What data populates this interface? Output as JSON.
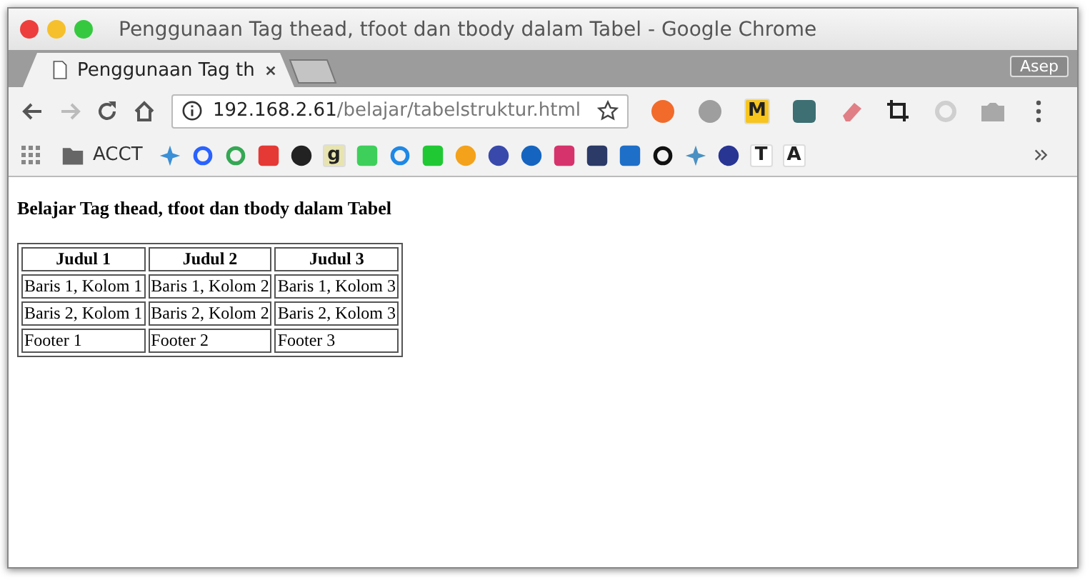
{
  "window": {
    "title": "Penggunaan Tag thead, tfoot dan tbody dalam Tabel - Google Chrome"
  },
  "tabs": [
    {
      "label": "Penggunaan Tag th",
      "selected": true
    }
  ],
  "profile": "Asep",
  "address": {
    "host": "192.168.2.61",
    "path": "/belajar/tabelstruktur.html"
  },
  "extensions": [
    {
      "kind": "dot",
      "color": "#f26b2a"
    },
    {
      "kind": "dot",
      "color": "#9e9e9e"
    },
    {
      "kind": "letter",
      "glyph": "M",
      "color": "#f7c51e"
    },
    {
      "kind": "square",
      "color": "#3d6f73"
    },
    {
      "kind": "eraser",
      "color": "#e07f85"
    },
    {
      "kind": "crop",
      "color": "#222222"
    },
    {
      "kind": "ring",
      "color": "#cfcfcf"
    },
    {
      "kind": "camera",
      "color": "#a8a8a8"
    }
  ],
  "bookmarks": [
    {
      "kind": "folder",
      "label": "ACCT"
    },
    {
      "kind": "star",
      "color": "#3a8fd6"
    },
    {
      "kind": "ring",
      "color": "#2962ff"
    },
    {
      "kind": "ring",
      "color": "#34a853"
    },
    {
      "kind": "square",
      "color": "#e53935"
    },
    {
      "kind": "dot",
      "color": "#222222"
    },
    {
      "kind": "letter",
      "glyph": "g",
      "color": "#e8e4b0"
    },
    {
      "kind": "square",
      "color": "#3ecf5a"
    },
    {
      "kind": "ring",
      "color": "#1e88e5"
    },
    {
      "kind": "square",
      "color": "#20c934"
    },
    {
      "kind": "dot",
      "color": "#f4a21b"
    },
    {
      "kind": "dot",
      "color": "#3949ab"
    },
    {
      "kind": "dot",
      "color": "#1565c0"
    },
    {
      "kind": "square",
      "color": "#d6336c"
    },
    {
      "kind": "square",
      "color": "#2b3a67"
    },
    {
      "kind": "square",
      "color": "#1e6fc8"
    },
    {
      "kind": "ring",
      "color": "#111111"
    },
    {
      "kind": "star",
      "color": "#4a90c2"
    },
    {
      "kind": "dot",
      "color": "#283593"
    },
    {
      "kind": "letter",
      "glyph": "T",
      "color": "#ffffff"
    },
    {
      "kind": "letter",
      "glyph": "A",
      "color": "#ffffff"
    }
  ],
  "page": {
    "heading": "Belajar Tag thead, tfoot dan tbody dalam Tabel",
    "table": {
      "columns": [
        "Judul 1",
        "Judul 2",
        "Judul 3"
      ],
      "rows": [
        [
          "Baris 1, Kolom 1",
          "Baris 1, Kolom 2",
          "Baris 1, Kolom 3"
        ],
        [
          "Baris 2, Kolom 1",
          "Baris 2, Kolom 2",
          "Baris 2, Kolom 3"
        ]
      ],
      "footer": [
        "Footer 1",
        "Footer 2",
        "Footer 3"
      ]
    }
  }
}
